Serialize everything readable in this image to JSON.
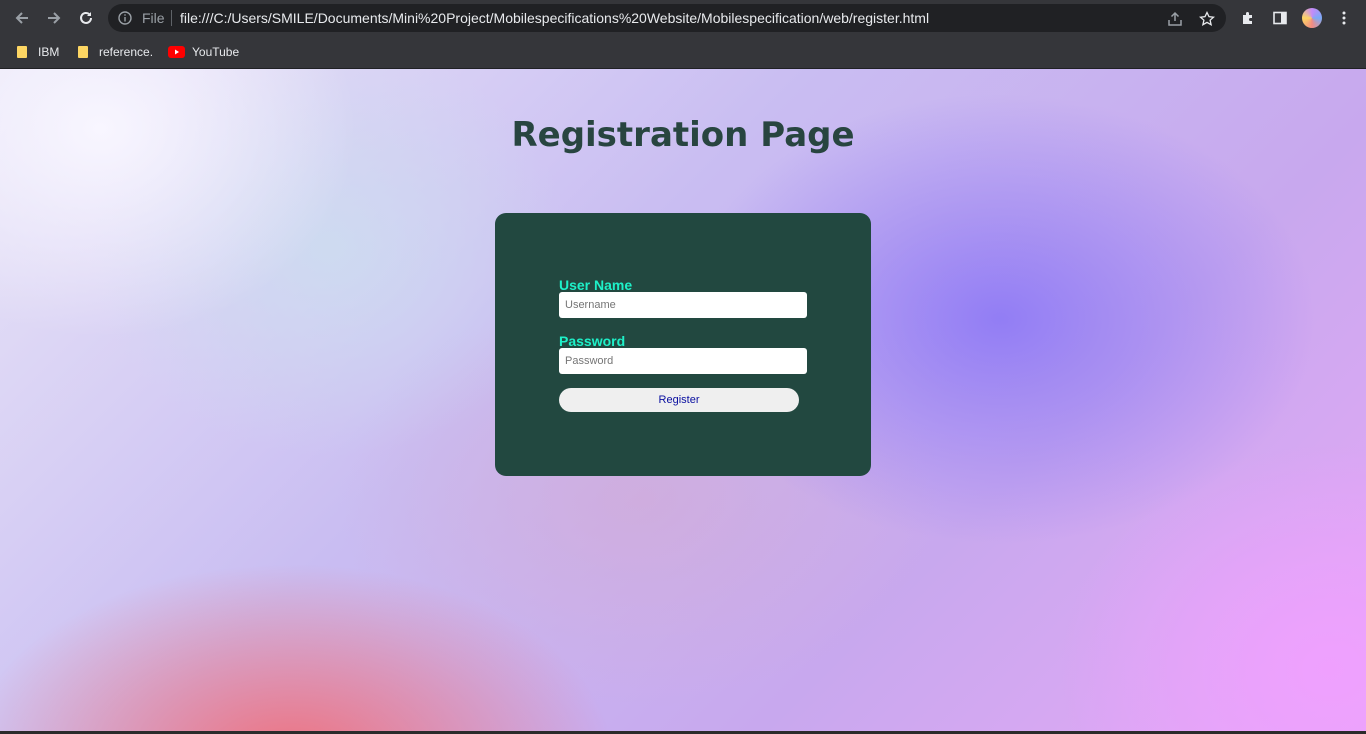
{
  "browser": {
    "file_label": "File",
    "url": "file:///C:/Users/SMILE/Documents/Mini%20Project/Mobilespecifications%20Website/Mobilespecification/web/register.html",
    "bookmarks": [
      {
        "label": "IBM",
        "icon": "folder-icon"
      },
      {
        "label": "reference.",
        "icon": "folder-icon"
      },
      {
        "label": "YouTube",
        "icon": "youtube-icon"
      }
    ]
  },
  "page": {
    "title": "Registration Page",
    "form": {
      "username_label": "User Name",
      "username_placeholder": "Username",
      "username_value": "",
      "password_label": "Password",
      "password_placeholder": "Password",
      "password_value": "",
      "submit_label": "Register"
    }
  },
  "colors": {
    "card_background": "#224840",
    "label_color": "#1ef0c8",
    "title_color": "#284540",
    "button_text": "#0a0fa0"
  }
}
